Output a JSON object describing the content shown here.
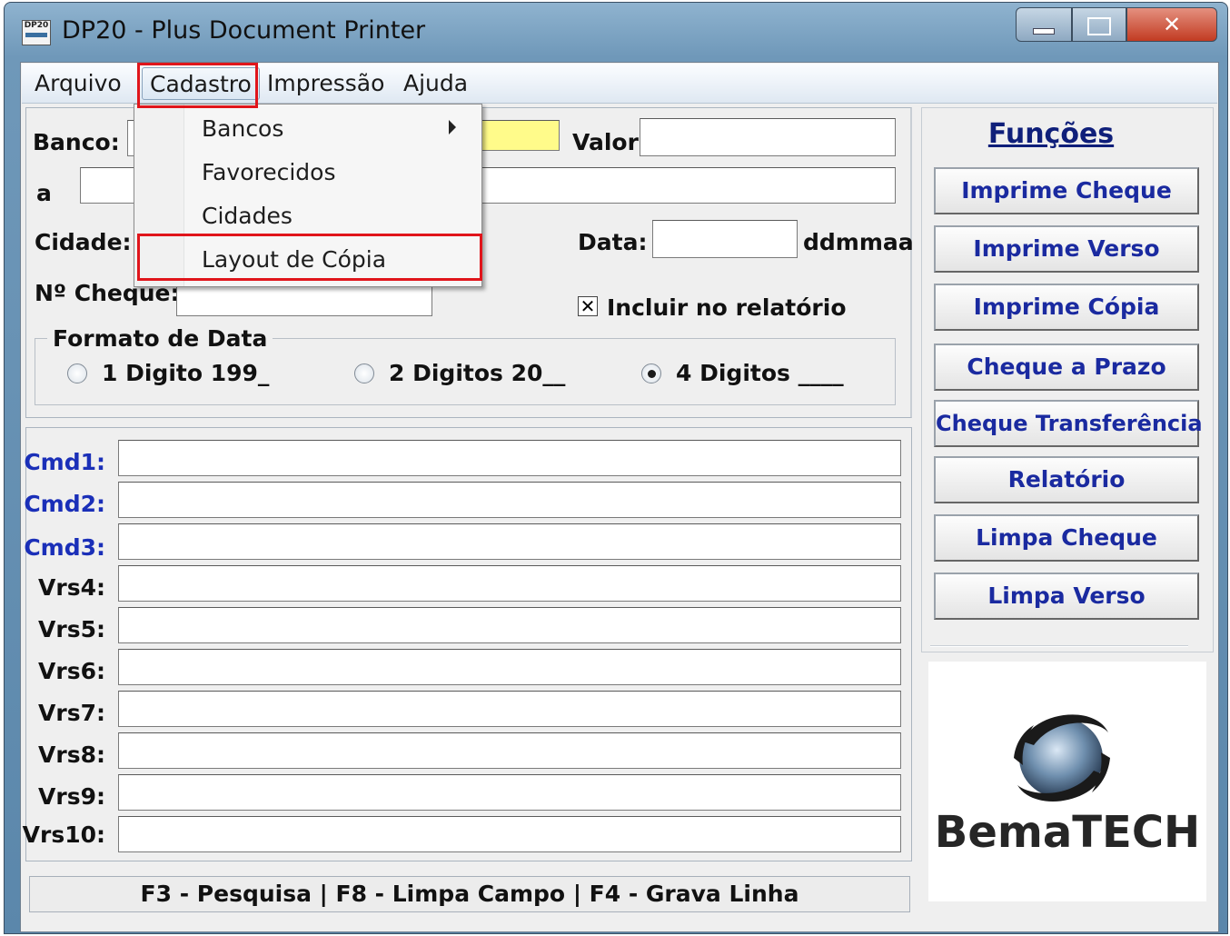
{
  "window": {
    "title": "DP20 - Plus Document Printer",
    "icon_label": "DP20"
  },
  "menubar": {
    "items": [
      "Arquivo",
      "Cadastro",
      "Impressão",
      "Ajuda"
    ]
  },
  "dropdown": {
    "items": [
      "Bancos",
      "Favorecidos",
      "Cidades",
      "Layout de Cópia"
    ]
  },
  "form": {
    "banco_label": "Banco:",
    "valor_label": "Valor:",
    "a_label": "a",
    "cidade_label": "Cidade:",
    "data_label": "Data:",
    "data_hint": "ddmmaa",
    "cheque_label": "Nº Cheque:",
    "incluir_label": "Incluir no relatório",
    "incluir_checked": "✕",
    "formato_title": "Formato de Data",
    "formato_options": [
      "1 Digito 199_",
      "2 Digitos 20__",
      "4 Digitos ____"
    ],
    "formato_selected": 2
  },
  "commands": {
    "labels": [
      "Cmd1:",
      "Cmd2:",
      "Cmd3:",
      "Vrs4:",
      "Vrs5:",
      "Vrs6:",
      "Vrs7:",
      "Vrs8:",
      "Vrs9:",
      "Vrs10:"
    ]
  },
  "status": {
    "text": "F3 - Pesquisa  |  F8 - Limpa Campo  |  F4 - Grava Linha"
  },
  "funcoes": {
    "title": "Funções",
    "buttons": [
      "Imprime Cheque",
      "Imprime Verso",
      "Imprime Cópia",
      "Cheque a Prazo",
      "Cheque Transferência",
      "Relatório",
      "Limpa Cheque",
      "Limpa Verso"
    ]
  },
  "logo": {
    "text": "BemaTECH"
  },
  "colors": {
    "highlight_box": "#e0151b",
    "cmd_label_blue": "#1a2fb8",
    "function_text": "#1a2aa0",
    "yellow_field": "#fffb8a"
  }
}
